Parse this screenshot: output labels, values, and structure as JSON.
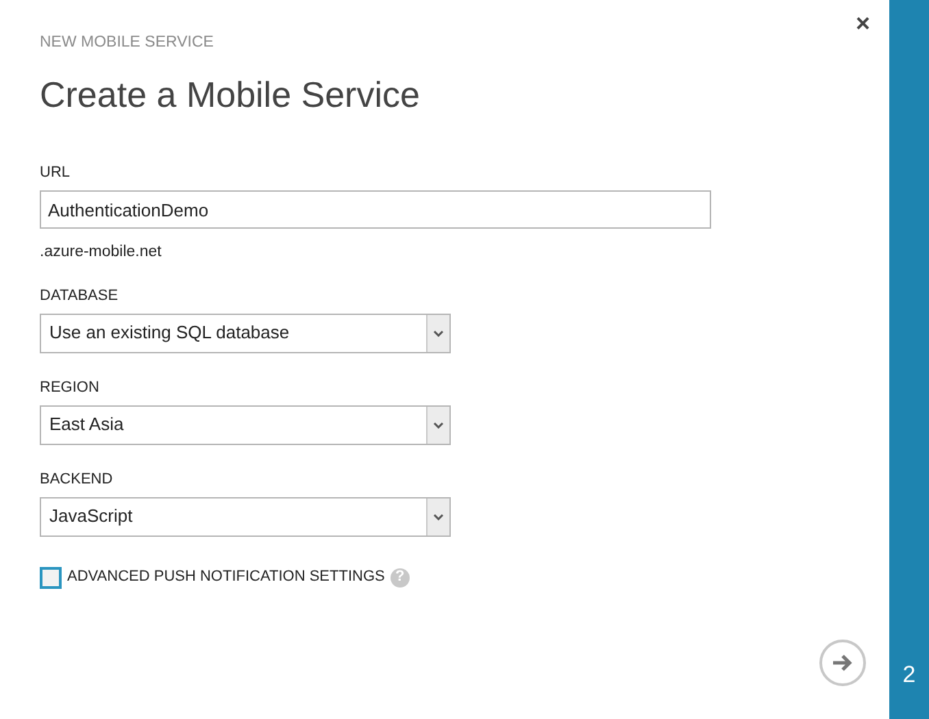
{
  "header": {
    "subtitle": "NEW MOBILE SERVICE",
    "title": "Create a Mobile Service",
    "close": "×"
  },
  "fields": [
    {
      "kind": "text",
      "label": "URL",
      "value": "AuthenticationDemo",
      "suffix": ".azure-mobile.net"
    },
    {
      "kind": "select",
      "label": "DATABASE",
      "value": "Use an existing SQL database"
    },
    {
      "kind": "select",
      "label": "REGION",
      "value": "East Asia"
    },
    {
      "kind": "select",
      "label": "BACKEND",
      "value": "JavaScript"
    }
  ],
  "checkbox": {
    "label": "ADVANCED PUSH NOTIFICATION SETTINGS",
    "checked": false,
    "help": "?"
  },
  "step": "2"
}
